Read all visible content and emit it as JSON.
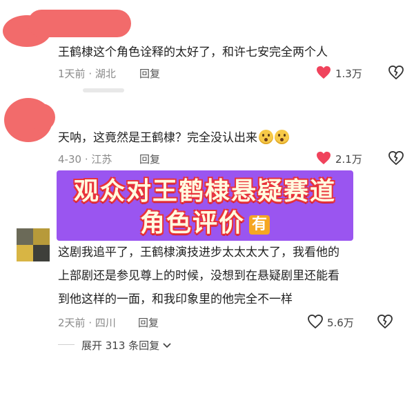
{
  "comments": [
    {
      "text": "王鹤棣这个角色诠释的太好了，和许七安完全两个人",
      "time": "1天前",
      "location": "湖北",
      "reply_label": "回复",
      "likes": "1.3万",
      "liked": true
    },
    {
      "text": "天呐，这竟然是王鹤棣？完全没认出来",
      "time": "4-30",
      "location": "江苏",
      "reply_label": "回复",
      "likes": "2.1万",
      "liked": true
    },
    {
      "lines": [
        "这剧我追平了，王鹤棣演技进步太太太大了，我看他的",
        "上部剧还是参见尊上的时候，没想到在悬疑剧里还能看",
        "到他这样的一面，和我印象里的他完全不一样"
      ],
      "time": "2天前",
      "location": "四川",
      "reply_label": "回复",
      "likes": "5.6万",
      "liked": false
    }
  ],
  "banner": {
    "line1": "观众对王鹤棣悬疑赛道",
    "line2": "角色评价",
    "badge": "有"
  },
  "expand_label": "展开 313 条回复",
  "colors": {
    "heart_liked": "#f0435c",
    "heart_outline": "#333333",
    "banner_bg": "#9a55f0",
    "banner_text": "#fffbe0",
    "banner_stroke": "#e9333a",
    "badge_bg": "#f5a623",
    "redaction": "#f26b6b"
  }
}
